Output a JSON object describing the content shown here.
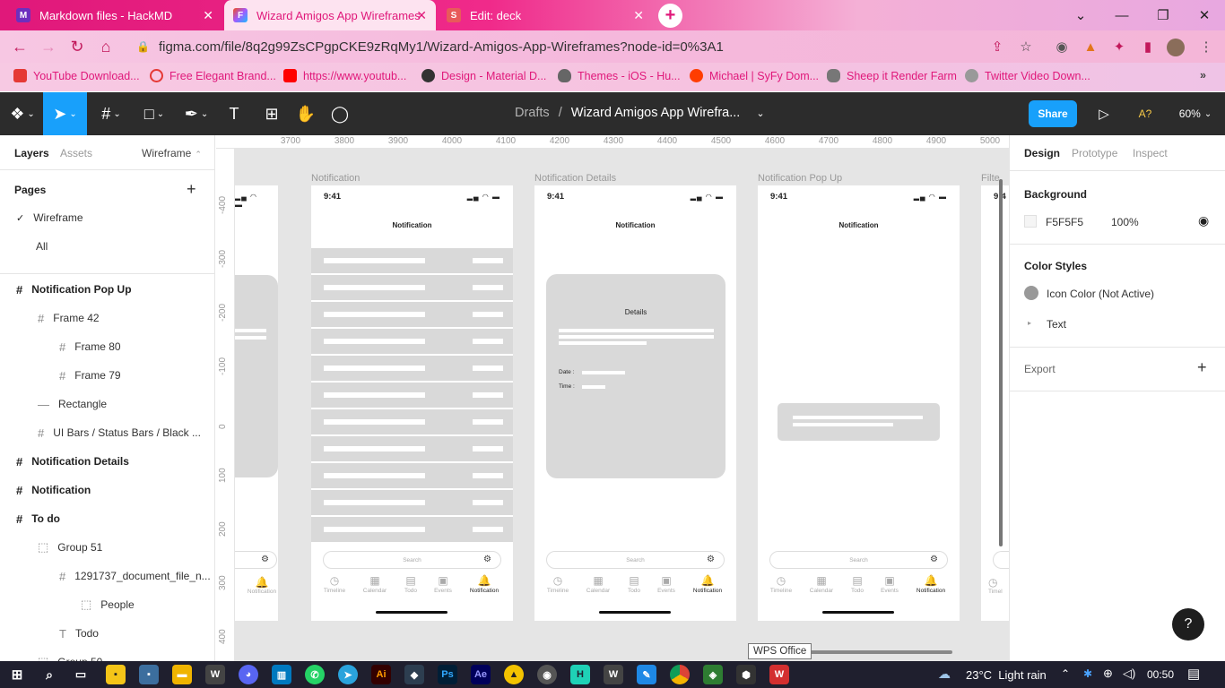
{
  "browser": {
    "tabs": [
      {
        "title": "Markdown files - HackMD",
        "fav": "M"
      },
      {
        "title": "Wizard Amigos App Wireframes",
        "fav": "F"
      },
      {
        "title": "Edit: deck",
        "fav": "S"
      }
    ],
    "url": "figma.com/file/8q2g99ZsCPgpCKE9zRqMy1/Wizard-Amigos-App-Wireframes?node-id=0%3A1",
    "bookmarks": [
      "YouTube Download...",
      "Free Elegant Brand...",
      "https://www.youtub...",
      "Design - Material D...",
      "Themes - iOS - Hu...",
      "Michael | SyFy Dom...",
      "Sheep it Render Farm",
      "Twitter Video Down..."
    ],
    "bookmarks_more": "»"
  },
  "figma": {
    "breadcrumb_parent": "Drafts",
    "breadcrumb_sep": "/",
    "file_title": "Wizard Amigos App Wirefra...",
    "share_label": "Share",
    "user_badge": "A?",
    "zoom": "60%"
  },
  "left_panel": {
    "tabs": [
      "Layers",
      "Assets"
    ],
    "page_selector": "Wireframe",
    "pages_header": "Pages",
    "pages": [
      "Wireframe",
      "All"
    ],
    "layers": [
      {
        "label": "Notification Pop Up",
        "bold": true,
        "indent": 0,
        "icon": "#"
      },
      {
        "label": "Frame 42",
        "bold": false,
        "indent": 1,
        "icon": "#"
      },
      {
        "label": "Frame 80",
        "bold": false,
        "indent": 2,
        "icon": "#"
      },
      {
        "label": "Frame 79",
        "bold": false,
        "indent": 2,
        "icon": "#"
      },
      {
        "label": "Rectangle",
        "bold": false,
        "indent": 1,
        "icon": "—"
      },
      {
        "label": "UI Bars / Status Bars / Black ...",
        "bold": false,
        "indent": 1,
        "icon": "#"
      },
      {
        "label": "Notification Details",
        "bold": true,
        "indent": 0,
        "icon": "#"
      },
      {
        "label": "Notification",
        "bold": true,
        "indent": 0,
        "icon": "#"
      },
      {
        "label": "To do",
        "bold": true,
        "indent": 0,
        "icon": "#"
      },
      {
        "label": "Group 51",
        "bold": false,
        "indent": 1,
        "icon": "⬚"
      },
      {
        "label": "1291737_document_file_n...",
        "bold": false,
        "indent": 2,
        "icon": "#"
      },
      {
        "label": "People",
        "bold": false,
        "indent": 3,
        "icon": "⬚"
      },
      {
        "label": "Todo",
        "bold": false,
        "indent": 2,
        "icon": "T"
      },
      {
        "label": "Group 50",
        "bold": false,
        "indent": 1,
        "icon": "⬚"
      }
    ]
  },
  "rulers": {
    "h": [
      "3700",
      "3800",
      "3900",
      "4000",
      "4100",
      "4200",
      "4300",
      "4400",
      "4500",
      "4600",
      "4700",
      "4800",
      "4900",
      "5000"
    ],
    "v": [
      "-400",
      "-300",
      "-200",
      "-100",
      "0",
      "100",
      "200",
      "300",
      "400"
    ]
  },
  "canvas": {
    "frames": [
      {
        "label": "Notification",
        "time": "9:41",
        "title": "Notification"
      },
      {
        "label": "Notification Details",
        "time": "9:41",
        "title": "Notification"
      },
      {
        "label": "Notification Pop Up",
        "time": "9:41",
        "title": "Notification"
      },
      {
        "label": "Filte",
        "time": "9:4",
        "title": ""
      }
    ],
    "details_card": {
      "title": "Details",
      "date_label": "Date :",
      "time_label": "Time :"
    },
    "search_placeholder": "Search",
    "nav_items": [
      "Timeline",
      "Calendar",
      "Todo",
      "Events",
      "Notification"
    ],
    "partial_nav_item": "Notification",
    "partial_left_nav": "Timel",
    "tooltip": "WPS Office"
  },
  "right_panel": {
    "tabs": [
      "Design",
      "Prototype",
      "Inspect"
    ],
    "background_header": "Background",
    "background_hex": "F5F5F5",
    "background_opacity": "100%",
    "color_styles_header": "Color Styles",
    "color_styles": [
      "Icon Color (Not Active)",
      "Text"
    ],
    "export_header": "Export"
  },
  "help_label": "?",
  "taskbar": {
    "weather": "23°C  Light rain",
    "time": "00:50"
  },
  "colors": {
    "figma_blue": "#18a0fb",
    "tab_pink": "#e0187a",
    "toolbar_dark": "#2c2c2c",
    "wireframe_gray": "#d9d9d9"
  }
}
